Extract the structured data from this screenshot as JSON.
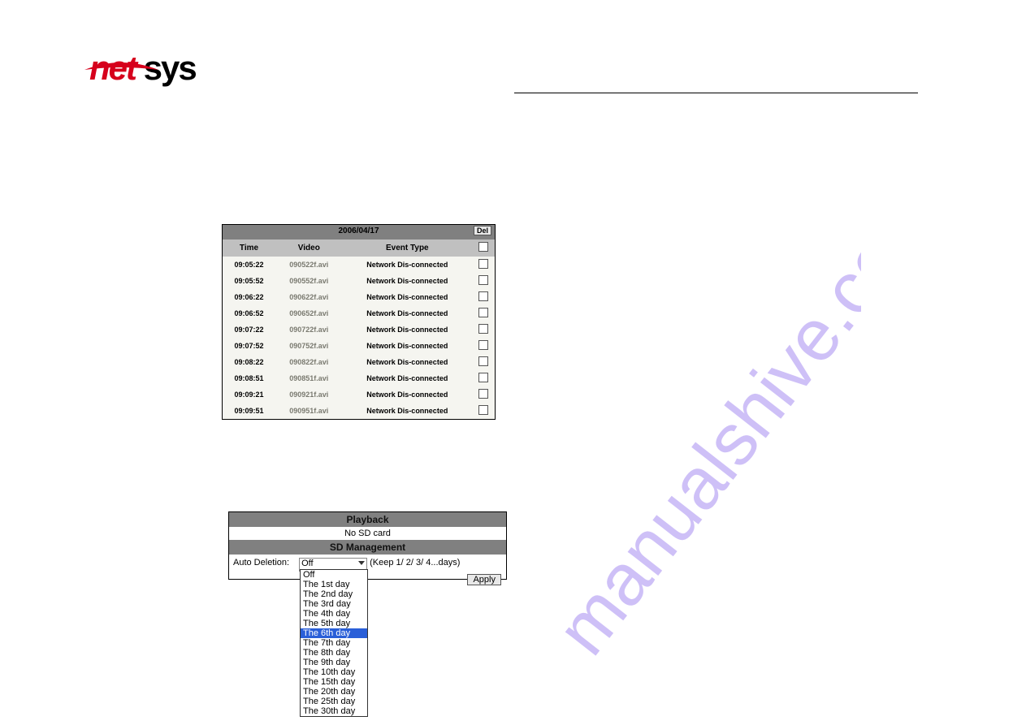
{
  "logo": {
    "part1": "net",
    "part2": "sys"
  },
  "table": {
    "date": "2006/04/17",
    "del_label": "Del",
    "headers": {
      "time": "Time",
      "video": "Video",
      "event": "Event Type"
    },
    "rows": [
      {
        "time": "09:05:22",
        "video": "090522f.avi",
        "event": "Network Dis-connected"
      },
      {
        "time": "09:05:52",
        "video": "090552f.avi",
        "event": "Network Dis-connected"
      },
      {
        "time": "09:06:22",
        "video": "090622f.avi",
        "event": "Network Dis-connected"
      },
      {
        "time": "09:06:52",
        "video": "090652f.avi",
        "event": "Network Dis-connected"
      },
      {
        "time": "09:07:22",
        "video": "090722f.avi",
        "event": "Network Dis-connected"
      },
      {
        "time": "09:07:52",
        "video": "090752f.avi",
        "event": "Network Dis-connected"
      },
      {
        "time": "09:08:22",
        "video": "090822f.avi",
        "event": "Network Dis-connected"
      },
      {
        "time": "09:08:51",
        "video": "090851f.avi",
        "event": "Network Dis-connected"
      },
      {
        "time": "09:09:21",
        "video": "090921f.avi",
        "event": "Network Dis-connected"
      },
      {
        "time": "09:09:51",
        "video": "090951f.avi",
        "event": "Network Dis-connected"
      }
    ]
  },
  "panel": {
    "title1": "Playback",
    "no_sd": "No SD card",
    "title2": "SD Management",
    "auto_del_label": "Auto Deletion:",
    "selected": "Off",
    "keep_text": "(Keep 1/ 2/ 3/ 4...days)",
    "apply_label": "Apply",
    "options": [
      "Off",
      "The 1st day",
      "The 2nd day",
      "The 3rd day",
      "The 4th day",
      "The 5th day",
      "The 6th day",
      "The 7th day",
      "The 8th day",
      "The 9th day",
      "The 10th day",
      "The 15th day",
      "The 20th day",
      "The 25th day",
      "The 30th day"
    ],
    "highlighted_option": "The 6th day"
  },
  "watermark_text": "manualshive.com"
}
